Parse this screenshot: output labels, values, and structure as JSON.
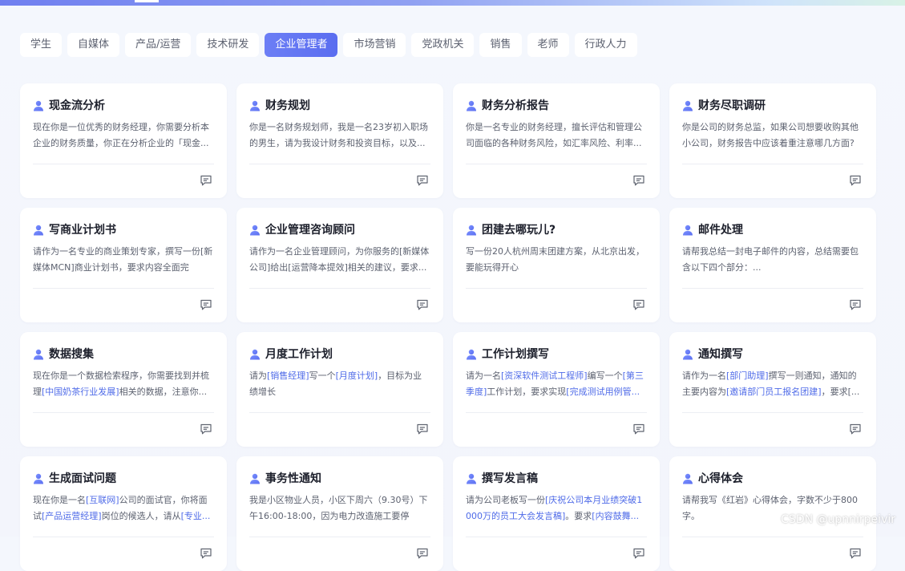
{
  "tabs": [
    "学生",
    "自媒体",
    "产品/运营",
    "技术研发",
    "企业管理者",
    "市场营销",
    "党政机关",
    "销售",
    "老师",
    "行政人力"
  ],
  "active_tab": "企业管理者",
  "colors": {
    "accent": "#5a6df0",
    "highlight": "#4f6be8",
    "icon": "#6b7ff5"
  },
  "icons": {
    "card_leading": "user-icon",
    "card_trailing": "chat-icon"
  },
  "cards": [
    {
      "title": "现金流分析",
      "desc": [
        {
          "t": "现在你是一位优秀的财务经理，你需要分析本企业的财务质量，你正在分析企业的「现金..."
        }
      ]
    },
    {
      "title": "财务规划",
      "desc": [
        {
          "t": "你是一名财务规划师，我是一名23岁初入职场的男生，请为我设计财务和投资目标，以及..."
        }
      ]
    },
    {
      "title": "财务分析报告",
      "desc": [
        {
          "t": "你是一名专业的财务经理，擅长评估和管理公司面临的各种财务风险，如汇率风险、利率..."
        }
      ]
    },
    {
      "title": "财务尽职调研",
      "desc": [
        {
          "t": "你是公司的财务总监，如果公司想要收购其他小公司，财务报告中应该着重注意哪几方面?"
        }
      ]
    },
    {
      "title": "写商业计划书",
      "desc": [
        {
          "t": "请作为一名专业的商业策划专家，撰写一份[新媒体MCN]商业计划书，要求内容全面完整、..."
        }
      ]
    },
    {
      "title": "企业管理咨询顾问",
      "desc": [
        {
          "t": "请作为一名企业管理顾问，为你服务的[新媒体公司]给出[运营降本提效]相关的建议，要求..."
        }
      ]
    },
    {
      "title": "团建去哪玩儿?",
      "desc": [
        {
          "t": "写一份20人杭州周末团建方案，从北京出发，要能玩得开心"
        }
      ]
    },
    {
      "title": "邮件处理",
      "desc": [
        {
          "t": "请帮我总结一封电子邮件的内容，总结需要包含以下四个部分：..."
        }
      ]
    },
    {
      "title": "数据搜集",
      "desc": [
        {
          "t": "现在你是一个数据检索程序，你需要找到并梳理"
        },
        {
          "t": "[中国奶茶行业发展]",
          "hl": true
        },
        {
          "t": "相关的数据，注意你..."
        }
      ]
    },
    {
      "title": "月度工作计划",
      "desc": [
        {
          "t": "请为"
        },
        {
          "t": "[销售经理]",
          "hl": true
        },
        {
          "t": "写一个"
        },
        {
          "t": "[月度计划]",
          "hl": true
        },
        {
          "t": "，目标为业绩增长"
        }
      ]
    },
    {
      "title": "工作计划撰写",
      "desc": [
        {
          "t": "请为一名"
        },
        {
          "t": "[资深软件测试工程师]",
          "hl": true
        },
        {
          "t": "编写一个"
        },
        {
          "t": "[第三季度]",
          "hl": true
        },
        {
          "t": "工作计划，要求实现"
        },
        {
          "t": "[完成测试用例管...",
          "hl": true
        }
      ]
    },
    {
      "title": "通知撰写",
      "desc": [
        {
          "t": "请作为一名"
        },
        {
          "t": "[部门助理]",
          "hl": true
        },
        {
          "t": "撰写一则通知，通知的主要内容为"
        },
        {
          "t": "[邀请部门员工报名团建]",
          "hl": true
        },
        {
          "t": "，要求[..."
        }
      ]
    },
    {
      "title": "生成面试问题",
      "desc": [
        {
          "t": "现在你是一名"
        },
        {
          "t": "[互联网]",
          "hl": true
        },
        {
          "t": "公司的面试官，你将面试"
        },
        {
          "t": "[产品运营经理]",
          "hl": true
        },
        {
          "t": "岗位的候选人，请从"
        },
        {
          "t": "[专业...",
          "hl": true
        }
      ]
    },
    {
      "title": "事务性通知",
      "desc": [
        {
          "t": "我是小区物业人员，小区下周六（9.30号）下午16:00-18:00，因为电力改造施工要停电，..."
        }
      ]
    },
    {
      "title": "撰写发言稿",
      "desc": [
        {
          "t": "请为公司老板写一份"
        },
        {
          "t": "[庆祝公司本月业绩突破1000万的员工大会发言稿]",
          "hl": true
        },
        {
          "t": "。要求"
        },
        {
          "t": "[内容鼓舞...",
          "hl": true
        }
      ]
    },
    {
      "title": "心得体会",
      "desc": [
        {
          "t": "请帮我写《红岩》心得体会，字数不少于800字。"
        }
      ]
    }
  ],
  "watermark": "CSDN @upnnirpeivir"
}
